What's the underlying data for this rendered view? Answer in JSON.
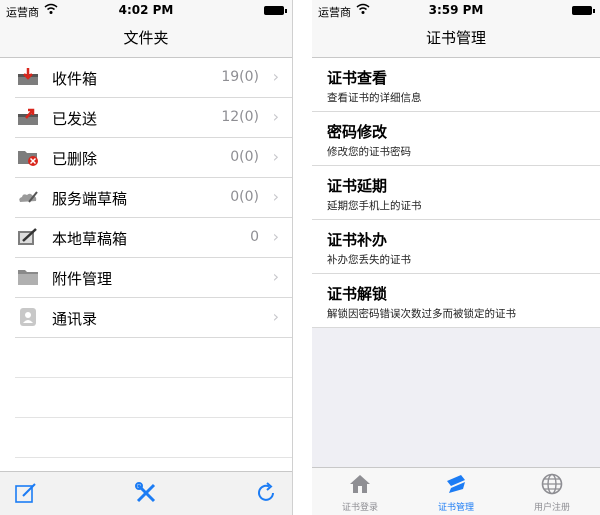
{
  "left": {
    "status": {
      "carrier": "运营商",
      "time": "4:02 PM"
    },
    "title": "文件夹",
    "items": [
      {
        "icon": "inbox-icon",
        "label": "收件箱",
        "count": "19(0)"
      },
      {
        "icon": "sent-icon",
        "label": "已发送",
        "count": "12(0)"
      },
      {
        "icon": "deleted-icon",
        "label": "已删除",
        "count": "0(0)"
      },
      {
        "icon": "server-drafts-icon",
        "label": "服务端草稿",
        "count": "0(0)"
      },
      {
        "icon": "local-drafts-icon",
        "label": "本地草稿箱",
        "count": "0"
      },
      {
        "icon": "attachment-folder-icon",
        "label": "附件管理",
        "count": ""
      },
      {
        "icon": "contacts-icon",
        "label": "通讯录",
        "count": ""
      }
    ],
    "toolbar": [
      "compose-icon",
      "tools-icon",
      "refresh-icon"
    ]
  },
  "right": {
    "status": {
      "carrier": "运营商",
      "time": "3:59 PM"
    },
    "title": "证书管理",
    "items": [
      {
        "title": "证书查看",
        "subtitle": "查看证书的详细信息"
      },
      {
        "title": "密码修改",
        "subtitle": "修改您的证书密码"
      },
      {
        "title": "证书延期",
        "subtitle": "延期您手机上的证书"
      },
      {
        "title": "证书补办",
        "subtitle": "补办您丢失的证书"
      },
      {
        "title": "证书解锁",
        "subtitle": "解锁因密码错误次数过多而被锁定的证书"
      }
    ],
    "tabs": [
      {
        "icon": "home-icon",
        "label": "证书登录"
      },
      {
        "icon": "certificate-icon",
        "label": "证书管理",
        "active": true
      },
      {
        "icon": "globe-icon",
        "label": "用户注册"
      }
    ]
  },
  "colors": {
    "accent": "#1c7cf4",
    "secondary_text": "#8e8e93",
    "separator": "#d9d9d9",
    "red_icon": "#d9261c"
  }
}
